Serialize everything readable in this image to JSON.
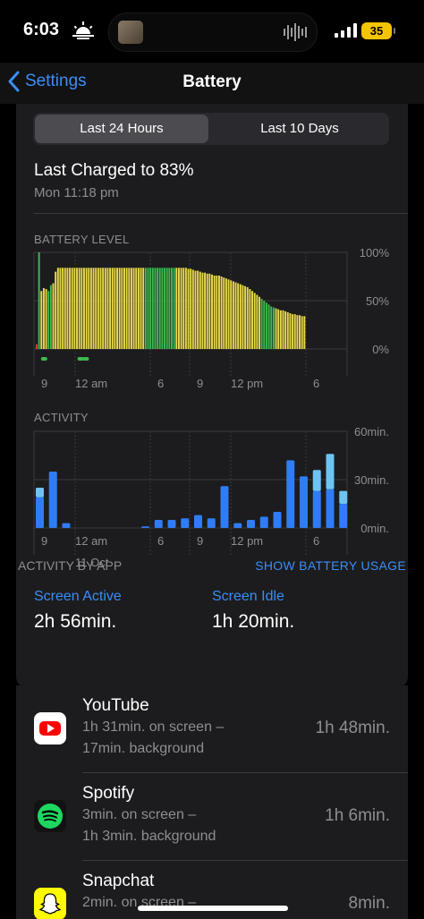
{
  "status_bar": {
    "time": "6:03",
    "battery_percent": "35",
    "icons": [
      "sun-horizon-icon",
      "cellular-signal-icon",
      "battery-icon",
      "waveform-icon"
    ]
  },
  "nav": {
    "back_label": "Settings",
    "title": "Battery"
  },
  "segments": {
    "left": "Last 24 Hours",
    "right": "Last 10 Days",
    "selected": "Last 24 Hours"
  },
  "last_charged": {
    "title": "Last Charged to 83%",
    "date": "Mon 11:18 pm"
  },
  "colors": {
    "accent": "#3a8ef6",
    "yellow": "#e9d94a",
    "green": "#3fb950",
    "red": "#e53935",
    "bar_blue": "#2f7cf6",
    "bar_light": "#6cc4f3"
  },
  "chart_data": [
    {
      "type": "bar",
      "title": "BATTERY LEVEL",
      "ylim": [
        0,
        100
      ],
      "y_ticks": [
        "100%",
        "50%",
        "0%"
      ],
      "x_ticks": [
        "9",
        "12 am",
        "6",
        "9",
        "12 pm",
        "6"
      ],
      "bar_colors_key": "yellow = on battery, green = charging, red = low",
      "values": [
        5,
        100,
        60,
        63,
        62,
        60,
        66,
        68,
        80,
        84,
        84,
        84,
        84,
        84,
        84,
        84,
        84,
        84,
        84,
        84,
        84,
        84,
        84,
        84,
        84,
        84,
        84,
        84,
        84,
        84,
        84,
        84,
        84,
        84,
        84,
        84,
        84,
        84,
        84,
        84,
        84,
        84,
        84,
        84,
        84,
        84,
        84,
        84,
        84,
        84,
        84,
        84,
        84,
        84,
        84,
        84,
        84,
        84,
        84,
        84,
        84,
        84,
        84,
        84,
        83,
        83,
        82,
        81,
        81,
        80,
        79,
        79,
        78,
        78,
        77,
        76,
        76,
        76,
        75,
        74,
        73,
        72,
        71,
        70,
        69,
        68,
        67,
        66,
        65,
        64,
        62,
        60,
        58,
        56,
        54,
        52,
        50,
        48,
        46,
        44,
        43,
        42,
        41,
        40,
        40,
        39,
        38,
        37,
        36,
        36,
        35,
        35,
        34,
        34
      ],
      "colors": [
        "r",
        "g",
        "y",
        "y",
        "y",
        "g",
        "g",
        "y",
        "y",
        "y",
        "y",
        "y",
        "y",
        "y",
        "y",
        "y",
        "y",
        "y",
        "y",
        "y",
        "y",
        "y",
        "y",
        "y",
        "y",
        "y",
        "y",
        "y",
        "y",
        "y",
        "y",
        "y",
        "y",
        "y",
        "y",
        "y",
        "y",
        "y",
        "y",
        "y",
        "y",
        "y",
        "y",
        "y",
        "y",
        "y",
        "g",
        "g",
        "g",
        "g",
        "g",
        "g",
        "g",
        "g",
        "g",
        "g",
        "g",
        "g",
        "g",
        "y",
        "y",
        "y",
        "y",
        "y",
        "y",
        "y",
        "y",
        "y",
        "y",
        "y",
        "y",
        "y",
        "y",
        "y",
        "y",
        "y",
        "y",
        "y",
        "y",
        "y",
        "y",
        "y",
        "y",
        "y",
        "y",
        "y",
        "y",
        "y",
        "y",
        "y",
        "y",
        "y",
        "y",
        "y",
        "y",
        "g",
        "g",
        "g",
        "g",
        "g",
        "g",
        "y",
        "y",
        "y",
        "y",
        "y",
        "y",
        "y",
        "y",
        "y",
        "y",
        "y",
        "y",
        "y"
      ],
      "charging_markers": [
        1,
        8,
        9
      ]
    },
    {
      "type": "bar",
      "title": "ACTIVITY",
      "ylim": [
        0,
        60
      ],
      "y_ticks": [
        "60min.",
        "30min.",
        "0min."
      ],
      "x_ticks": [
        "9",
        "12 am",
        "6",
        "9",
        "12 pm",
        "6"
      ],
      "x_sub_label": "11 Oct",
      "units": "min.",
      "series": [
        {
          "values": [
            19,
            35,
            3,
            0,
            0,
            0,
            0,
            0,
            1,
            5,
            5,
            6,
            8,
            6,
            26,
            3,
            5,
            7,
            10,
            42,
            32,
            23,
            24,
            15
          ]
        },
        {
          "values": [
            6,
            0,
            0,
            0,
            0,
            0,
            0,
            0,
            0,
            0,
            0,
            0,
            0,
            0,
            0,
            0,
            0,
            0,
            0,
            0,
            0,
            13,
            22,
            8
          ]
        }
      ]
    }
  ],
  "stats": {
    "active_label": "Screen Active",
    "active_value": "2h 56min.",
    "idle_label": "Screen Idle",
    "idle_value": "1h 20min."
  },
  "apps_header": {
    "label": "ACTIVITY BY APP",
    "link": "SHOW BATTERY USAGE"
  },
  "apps": [
    {
      "name": "YouTube",
      "line1": "1h 31min. on screen –",
      "line2": "17min. background",
      "time": "1h 48min.",
      "icon": "youtube-icon"
    },
    {
      "name": "Spotify",
      "line1": "3min. on screen –",
      "line2": "1h 3min. background",
      "time": "1h 6min.",
      "icon": "spotify-icon"
    },
    {
      "name": "Snapchat",
      "line1": "2min. on screen –",
      "line2": "",
      "time": "8min.",
      "icon": "snapchat-icon"
    }
  ]
}
